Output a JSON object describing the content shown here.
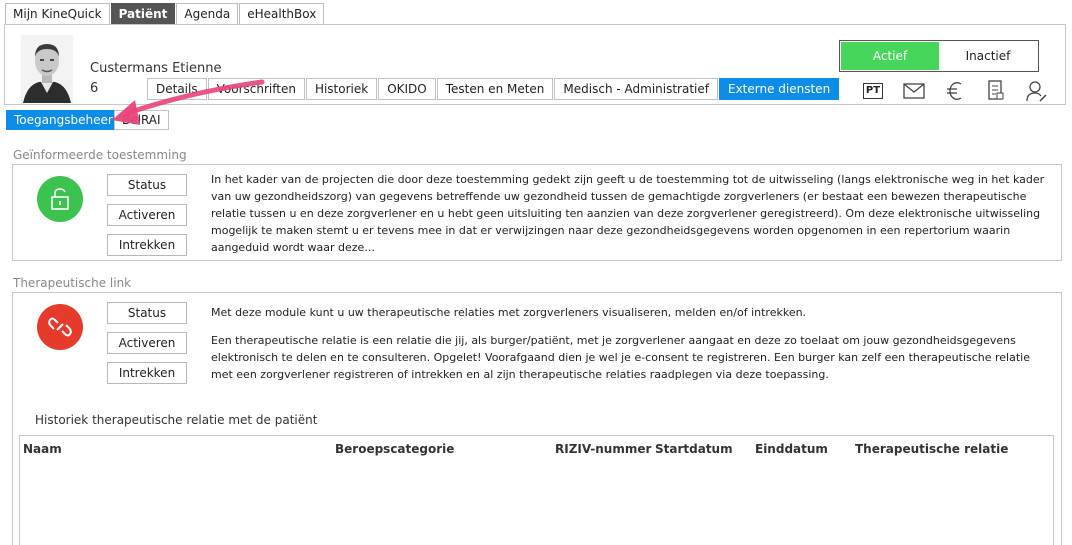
{
  "top_nav": {
    "tabs": [
      {
        "label": "Mijn KineQuick",
        "active": false
      },
      {
        "label": "Patiënt",
        "active": true
      },
      {
        "label": "Agenda",
        "active": false
      },
      {
        "label": "eHealthBox",
        "active": false
      }
    ]
  },
  "patient": {
    "name": "Custermans Etienne",
    "number": "6"
  },
  "patient_tabs": [
    {
      "label": "Details",
      "active": false
    },
    {
      "label": "Voorschriften",
      "active": false
    },
    {
      "label": "Historiek",
      "active": false
    },
    {
      "label": "OKIDO",
      "active": false
    },
    {
      "label": "Testen en Meten",
      "active": false
    },
    {
      "label": "Medisch - Administratief",
      "active": false
    },
    {
      "label": "Externe diensten",
      "active": true
    }
  ],
  "status_toggle": {
    "active_label": "Actief",
    "inactive_label": "Inactief",
    "selected": "Actief"
  },
  "header_icons": {
    "pt_label": "PT",
    "icons": [
      "pt-icon",
      "mail-icon",
      "euro-icon",
      "document-icon",
      "user-edit-icon"
    ]
  },
  "sub_tabs": [
    {
      "label": "Toegangsbeheer",
      "active": true
    },
    {
      "label": "BelRAI",
      "active": false
    }
  ],
  "informed_consent": {
    "title": "Geïnformeerde toestemming",
    "buttons": {
      "status": "Status",
      "activate": "Activeren",
      "revoke": "Intrekken"
    },
    "text": "In het kader van de projecten die door deze toestemming gedekt zijn geeft u de toestemming tot de uitwisseling (langs elektronische weg in het kader van uw gezondheidszorg) van gegevens betreffende uw gezondheid tussen de gemachtigde zorgverleners (er bestaat een bewezen therapeutische relatie tussen u en deze zorgverlener en u hebt geen uitsluiting ten aanzien van deze zorgverlener geregistreerd). Om deze elektronische uitwisseling mogelijk te maken stemt u er tevens mee in dat er verwijzingen naar deze gezondheidsgegevens worden opgenomen in een repertorium waarin aangeduid wordt waar deze...",
    "icon_color": "#3cc24f"
  },
  "therapeutic_link": {
    "title": "Therapeutische link",
    "buttons": {
      "status": "Status",
      "activate": "Activeren",
      "revoke": "Intrekken"
    },
    "text_1": "Met deze module kunt u uw therapeutische relaties met zorgverleners visualiseren, melden en/of intrekken.",
    "text_2": "Een therapeutische relatie is een relatie die jij, als burger/patiënt, met je zorgverlener aangaat en deze zo toelaat om jouw gezondheidsgegevens elektronisch te delen en te consulteren. Opgelet! Voorafgaand dien je wel je e-consent te registreren. Een burger kan zelf een therapeutische relatie met een zorgverlener registreren of intrekken en al zijn therapeutische relaties raadplegen via deze toepassing.",
    "icon_color": "#e63b2a"
  },
  "history": {
    "title": "Historiek therapeutische relatie met de patiënt",
    "columns": [
      "Naam",
      "Beroepscategorie",
      "RIZIV-nummer",
      "Startdatum",
      "Einddatum",
      "Therapeutische relatie"
    ]
  },
  "colors": {
    "accent": "#0c8ee8",
    "active_green": "#45d65a",
    "annotation_arrow": "#e8457a"
  }
}
